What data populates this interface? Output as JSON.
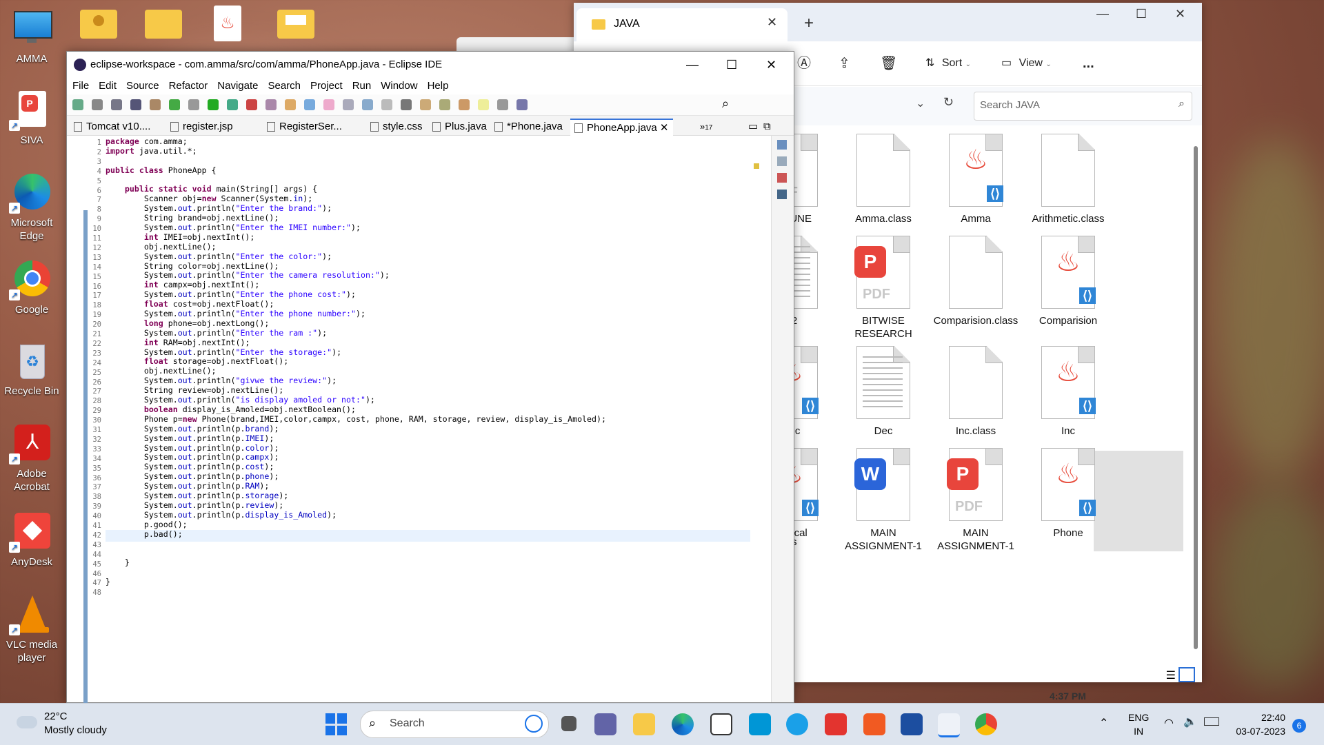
{
  "desktop": {
    "icons": [
      {
        "label": "AMMA",
        "icon": "monitor-icon"
      },
      {
        "label": "SIVA",
        "icon": "pdf-icon"
      },
      {
        "label": "Microsoft Edge",
        "icon": "edge-icon"
      },
      {
        "label": "Google",
        "icon": "chrome-icon"
      },
      {
        "label": "Recycle Bin",
        "icon": "recycle-bin-icon"
      },
      {
        "label": "Adobe Acrobat",
        "icon": "acrobat-icon"
      },
      {
        "label": "AnyDesk",
        "icon": "anydesk-icon"
      },
      {
        "label": "VLC media player",
        "icon": "vlc-icon"
      }
    ]
  },
  "explorer": {
    "tab_title": "JAVA",
    "toolbar": {
      "sort": "Sort",
      "view": "View",
      "more": "..."
    },
    "search_placeholder": "Search JAVA",
    "files": [
      {
        "name": "19 JUNE",
        "type": "pdf"
      },
      {
        "name": "Amma.class",
        "type": "blank"
      },
      {
        "name": "Amma",
        "type": "java"
      },
      {
        "name": "Arithmetic.class",
        "type": "blank"
      },
      {
        "name": "B2",
        "type": "doc"
      },
      {
        "name": "BITWISE RESEARCH",
        "type": "pdf"
      },
      {
        "name": "Comparision.class",
        "type": "blank"
      },
      {
        "name": "Comparision",
        "type": "java"
      },
      {
        "name": "Dec",
        "type": "java"
      },
      {
        "name": "Dec",
        "type": "text"
      },
      {
        "name": "Inc.class",
        "type": "blank"
      },
      {
        "name": "Inc",
        "type": "java"
      },
      {
        "name": "Logical",
        "type": "java"
      },
      {
        "name": "MAIN ASSIGNMENT-1",
        "type": "word"
      },
      {
        "name": "MAIN ASSIGNMENT-1",
        "type": "pdf"
      },
      {
        "name": "Phone",
        "type": "java"
      }
    ],
    "partial_label": "s",
    "time_label": "4:37 PM"
  },
  "eclipse": {
    "title": "eclipse-workspace - com.amma/src/com/amma/PhoneApp.java - Eclipse IDE",
    "menu": [
      "File",
      "Edit",
      "Source",
      "Refactor",
      "Navigate",
      "Search",
      "Project",
      "Run",
      "Window",
      "Help"
    ],
    "tabs": [
      "Tomcat v10....",
      "register.jsp",
      "RegisterSer...",
      "style.css",
      "Plus.java",
      "*Phone.java",
      "PhoneApp.java"
    ],
    "overflow_count": "17",
    "line_numbers": [
      "1",
      "2",
      "3",
      "4",
      "5",
      "6",
      "7",
      "8",
      "9",
      "10",
      "11",
      "12",
      "13",
      "14",
      "15",
      "16",
      "17",
      "18",
      "19",
      "20",
      "21",
      "22",
      "23",
      "24",
      "25",
      "26",
      "27",
      "28",
      "29",
      "30",
      "31",
      "32",
      "33",
      "34",
      "35",
      "36",
      "37",
      "38",
      "39",
      "40",
      "41",
      "42",
      "43",
      "44",
      "45",
      "46",
      "47",
      "48"
    ],
    "code": [
      "package com.amma;",
      "import java.util.*;",
      "",
      "public class PhoneApp {",
      "",
      "    public static void main(String[] args) {",
      "        Scanner obj=new Scanner(System.in);",
      "        System.out.println(\"Enter the brand:\");",
      "        String brand=obj.nextLine();",
      "        System.out.println(\"Enter the IMEI number:\");",
      "        int IMEI=obj.nextInt();",
      "        obj.nextLine();",
      "        System.out.println(\"Enter the color:\");",
      "        String color=obj.nextLine();",
      "        System.out.println(\"Enter the camera resolution:\");",
      "        int campx=obj.nextInt();",
      "        System.out.println(\"Enter the phone cost:\");",
      "        float cost=obj.nextFloat();",
      "        System.out.println(\"Enter the phone number:\");",
      "        long phone=obj.nextLong();",
      "        System.out.println(\"Enter the ram :\");",
      "        int RAM=obj.nextInt();",
      "        System.out.println(\"Enter the storage:\");",
      "        float storage=obj.nextFloat();",
      "        obj.nextLine();",
      "        System.out.println(\"givwe the review:\");",
      "        String review=obj.nextLine();",
      "        System.out.println(\"is display amoled or not:\");",
      "        boolean display_is_Amoled=obj.nextBoolean();",
      "        Phone p=new Phone(brand,IMEI,color,campx, cost, phone, RAM, storage, review, display_is_Amoled);",
      "        System.out.println(p.brand);",
      "        System.out.println(p.IMEI);",
      "        System.out.println(p.color);",
      "        System.out.println(p.campx);",
      "        System.out.println(p.cost);",
      "        System.out.println(p.phone);",
      "        System.out.println(p.RAM);",
      "        System.out.println(p.storage);",
      "        System.out.println(p.review);",
      "        System.out.println(p.display_is_Amoled);",
      "        p.good();",
      "        p.bad();",
      "",
      "",
      "    }",
      "",
      "}",
      ""
    ]
  },
  "taskbar": {
    "weather_temp": "22°C",
    "weather_desc": "Mostly cloudy",
    "search_label": "Search",
    "lang_top": "ENG",
    "lang_bottom": "IN",
    "time": "22:40",
    "date": "03-07-2023",
    "notif_count": "6"
  }
}
